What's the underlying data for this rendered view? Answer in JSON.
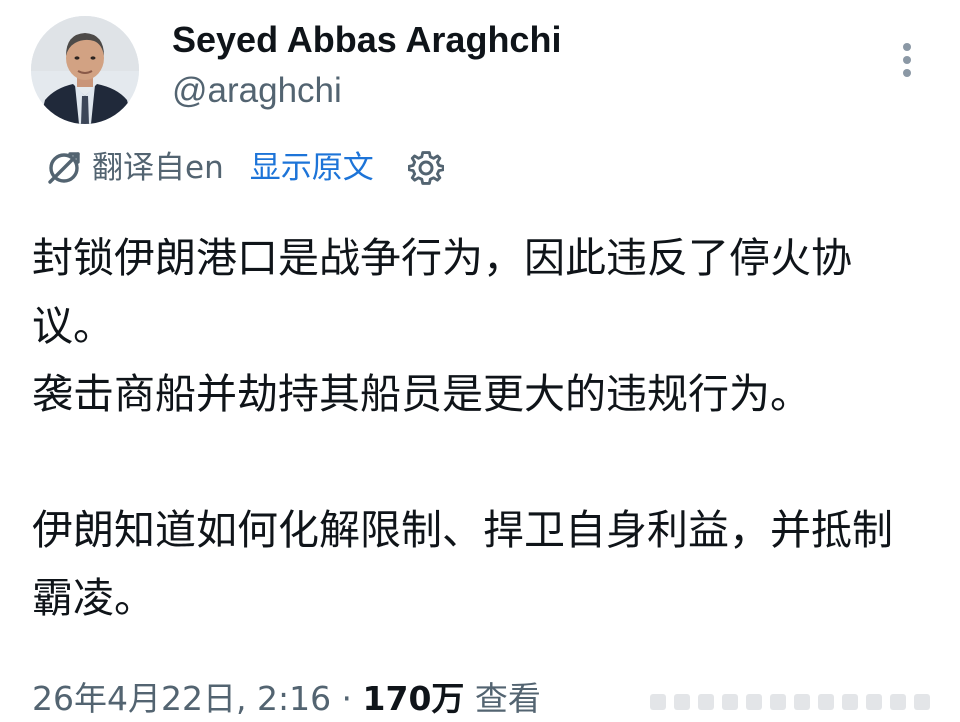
{
  "author": {
    "display_name": "Seyed Abbas Araghchi",
    "handle": "@araghchi",
    "avatar_icon": "user-avatar-photo"
  },
  "translation_bar": {
    "icon": "translate-icon",
    "translated_from_label": "翻译自en",
    "show_original_label": "显示原文",
    "settings_icon": "gear-icon"
  },
  "tweet": {
    "paragraphs": [
      "封锁伊朗港口是战争行为，因此违反了停火协议。\n袭击商船并劫持其船员是更大的违规行为。",
      "伊朗知道如何化解限制、捍卫自身利益，并抵制霸凌。"
    ]
  },
  "meta": {
    "timestamp": "26年4月22日, 2:16",
    "separator": " · ",
    "views_count": "170万",
    "views_label": " 查看"
  },
  "colors": {
    "text_primary": "#0f1419",
    "text_secondary": "#536471",
    "link": "#1d74d8"
  }
}
